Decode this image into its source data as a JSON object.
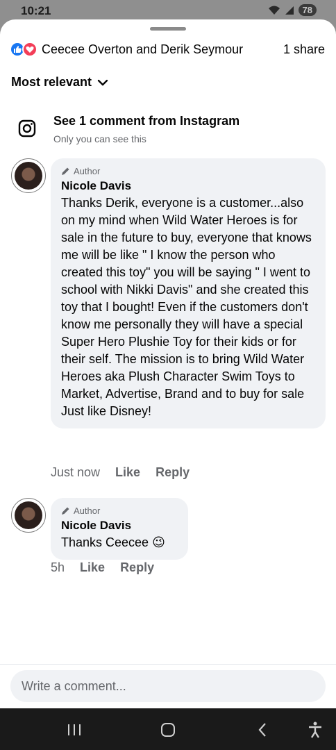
{
  "status_bar": {
    "time": "10:21",
    "battery": "78"
  },
  "header": {
    "reaction_names": "Ceecee Overton and Derik Seymour",
    "share_count": "1 share",
    "reaction_colors": {
      "like": "#1877f2",
      "love": "#f33e58"
    }
  },
  "sort": {
    "label": "Most relevant",
    "icon": "chevron-down-icon"
  },
  "instagram_notice": {
    "title": "See 1 comment from Instagram",
    "subtitle": "Only you can see this",
    "icon": "instagram-icon"
  },
  "comments": [
    {
      "badge": "Author",
      "name": "Nicole Davis",
      "text": "Thanks Derik, everyone is a customer...also on my mind when Wild Water Heroes is for sale in the future to buy, everyone that knows me will be like \" I know the person who created this toy\" you will be saying \" I went to school with Nikki Davis\" and she created this toy that I bought! Even if the customers don't know me personally they will have a special Super Hero Plushie Toy for their kids or for their self. The mission is to bring Wild Water Heroes aka Plush Character Swim Toys to Market, Advertise, Brand and to buy for sale Just like Disney!",
      "time": "Just now",
      "like_label": "Like",
      "reply_label": "Reply"
    },
    {
      "badge": "Author",
      "name": "Nicole Davis",
      "text": "Thanks Ceecee 😉",
      "time": "5h",
      "like_label": "Like",
      "reply_label": "Reply"
    }
  ],
  "composer": {
    "placeholder": "Write a comment..."
  },
  "nav": {
    "icons": [
      "recent-apps-icon",
      "home-icon",
      "back-icon",
      "accessibility-icon"
    ]
  }
}
